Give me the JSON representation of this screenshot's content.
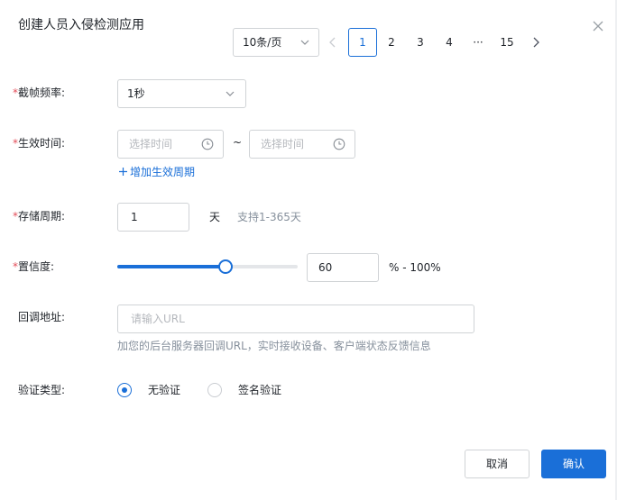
{
  "dialog": {
    "title": "创建人员入侵检测应用"
  },
  "pagination": {
    "page_size": "10条/页",
    "pages": [
      "1",
      "2",
      "3",
      "4",
      "···",
      "15"
    ],
    "current": "1"
  },
  "form": {
    "frame_rate": {
      "label": "截帧频率:",
      "value": "1秒"
    },
    "effective_time": {
      "label": "生效时间:",
      "start_placeholder": "选择时间",
      "end_placeholder": "选择时间",
      "separator": "~",
      "add_period": "增加生效周期"
    },
    "storage": {
      "label": "存储周期:",
      "value": "1",
      "unit": "天",
      "hint": "支持1-365天"
    },
    "confidence": {
      "label": "置信度:",
      "value": "60",
      "suffix": "% - 100%",
      "slider_percent": 60
    },
    "callback": {
      "label": "回调地址:",
      "placeholder": "请输入URL",
      "hint": "加您的后台服务器回调URL，实时接收设备、客户端状态反馈信息"
    },
    "auth_type": {
      "label": "验证类型:",
      "options": [
        "无验证",
        "签名验证"
      ],
      "selected": "无验证"
    }
  },
  "footer": {
    "cancel": "取消",
    "confirm": "确认"
  },
  "colors": {
    "primary": "#1a6fd8",
    "required": "#e34d59"
  }
}
